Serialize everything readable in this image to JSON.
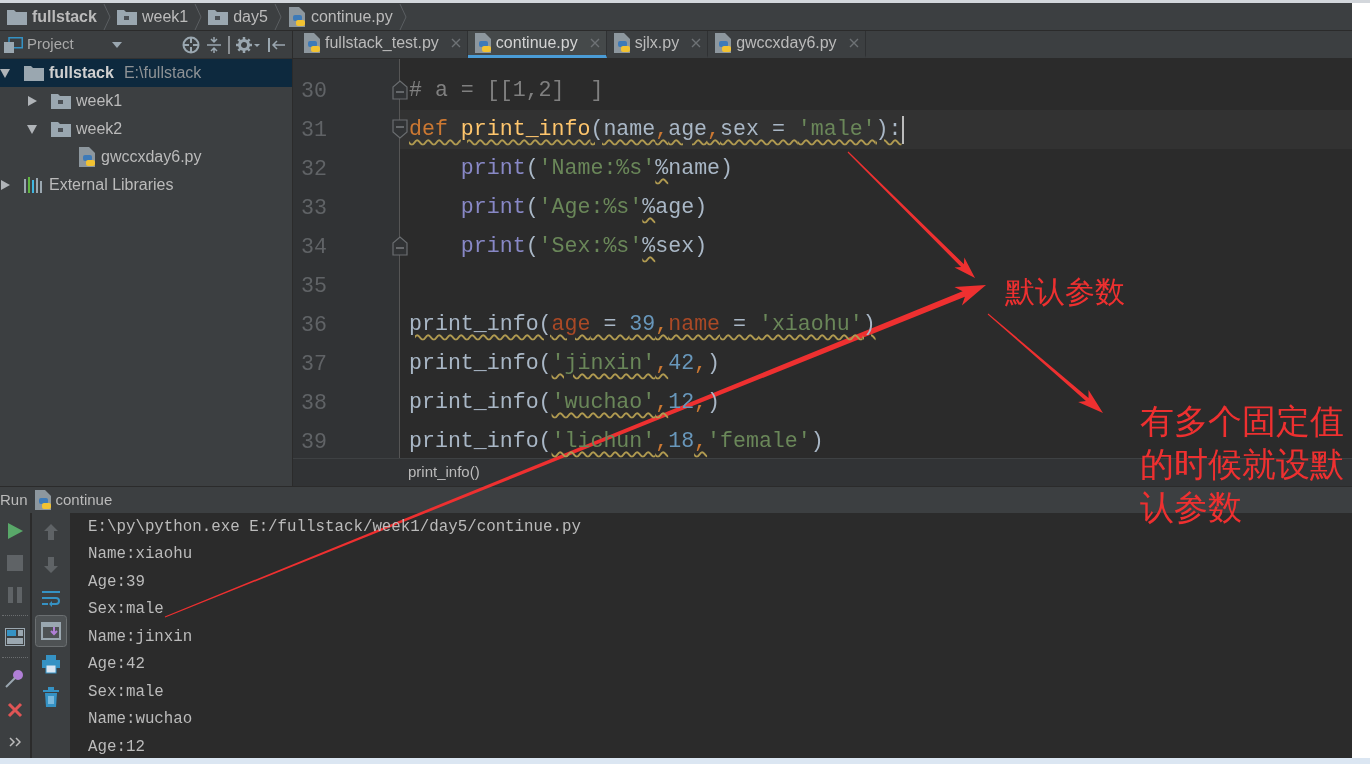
{
  "breadcrumbs": [
    {
      "label": "fullstack",
      "kind": "project"
    },
    {
      "label": "week1",
      "kind": "module"
    },
    {
      "label": "day5",
      "kind": "module"
    },
    {
      "label": "continue.py",
      "kind": "python"
    }
  ],
  "project_panel": {
    "title": "Project",
    "tree": [
      {
        "label": "fullstack",
        "path": "E:\\fullstack",
        "kind": "project",
        "expanded": true,
        "selected": true,
        "children": [
          {
            "label": "week1",
            "kind": "module",
            "expanded": false,
            "selected": false
          },
          {
            "label": "week2",
            "kind": "module",
            "expanded": true,
            "selected": false,
            "children": [
              {
                "label": "gwccxday6.py",
                "kind": "python",
                "selected": false
              }
            ]
          }
        ]
      },
      {
        "label": "External Libraries",
        "kind": "library",
        "expanded": false,
        "selected": false
      }
    ]
  },
  "editor": {
    "tabs": [
      {
        "label": "fullstack_test.py",
        "selected": false
      },
      {
        "label": "continue.py",
        "selected": true
      },
      {
        "label": "sjlx.py",
        "selected": false
      },
      {
        "label": "gwccxday6.py",
        "selected": false
      }
    ],
    "lines": [
      {
        "number": "30",
        "fold_start": false,
        "fold_end": true,
        "current": false,
        "tokens": [
          {
            "text": "# a = [[1,2]  ]",
            "kind": "comment",
            "warning": false
          }
        ]
      },
      {
        "number": "31",
        "fold_start": true,
        "fold_end": false,
        "current": true,
        "tokens": [
          {
            "text": "def ",
            "kind": "keyword",
            "warning": true
          },
          {
            "text": "print_info",
            "kind": "function",
            "warning": true
          },
          {
            "text": "(name",
            "kind": "plain",
            "warning": true
          },
          {
            "text": ",",
            "kind": "punct",
            "warning": true
          },
          {
            "text": "age",
            "kind": "plain",
            "warning": true
          },
          {
            "text": ",",
            "kind": "punct",
            "warning": true
          },
          {
            "text": "sex = ",
            "kind": "plain",
            "warning": true
          },
          {
            "text": "'male'",
            "kind": "string",
            "warning": true
          },
          {
            "text": "):",
            "kind": "plain",
            "warning": true
          }
        ]
      },
      {
        "number": "32",
        "fold_start": false,
        "fold_end": false,
        "current": false,
        "tokens": [
          {
            "text": "    print",
            "kind": "builtin",
            "warning": false
          },
          {
            "text": "(",
            "kind": "plain",
            "warning": false
          },
          {
            "text": "'Name:%s'",
            "kind": "string",
            "warning": false
          },
          {
            "text": "%",
            "kind": "plain",
            "warning": true
          },
          {
            "text": "name)",
            "kind": "plain",
            "warning": false
          }
        ]
      },
      {
        "number": "33",
        "fold_start": false,
        "fold_end": false,
        "current": false,
        "tokens": [
          {
            "text": "    print",
            "kind": "builtin",
            "warning": false
          },
          {
            "text": "(",
            "kind": "plain",
            "warning": false
          },
          {
            "text": "'Age:%s'",
            "kind": "string",
            "warning": false
          },
          {
            "text": "%",
            "kind": "plain",
            "warning": true
          },
          {
            "text": "age)",
            "kind": "plain",
            "warning": false
          }
        ]
      },
      {
        "number": "34",
        "fold_start": false,
        "fold_end": true,
        "current": false,
        "tokens": [
          {
            "text": "    print",
            "kind": "builtin",
            "warning": false
          },
          {
            "text": "(",
            "kind": "plain",
            "warning": false
          },
          {
            "text": "'Sex:%s'",
            "kind": "string",
            "warning": false
          },
          {
            "text": "%",
            "kind": "plain",
            "warning": true
          },
          {
            "text": "sex)",
            "kind": "plain",
            "warning": false
          }
        ]
      },
      {
        "number": "35",
        "fold_start": false,
        "fold_end": false,
        "current": false
      },
      {
        "number": "36",
        "fold_start": false,
        "fold_end": false,
        "current": false,
        "tokens": [
          {
            "text": "print_info(",
            "kind": "plain",
            "warning": true
          },
          {
            "text": "age",
            "kind": "param",
            "warning": true
          },
          {
            "text": " = ",
            "kind": "plain",
            "warning": true
          },
          {
            "text": "39",
            "kind": "number",
            "warning": true
          },
          {
            "text": ",",
            "kind": "punct",
            "warning": true
          },
          {
            "text": "name",
            "kind": "param",
            "warning": true
          },
          {
            "text": " = ",
            "kind": "plain",
            "warning": true
          },
          {
            "text": "'xiaohu'",
            "kind": "string",
            "warning": true
          },
          {
            "text": ")",
            "kind": "plain",
            "warning": true
          }
        ]
      },
      {
        "number": "37",
        "fold_start": false,
        "fold_end": false,
        "current": false,
        "tokens": [
          {
            "text": "print_info(",
            "kind": "plain",
            "warning": false
          },
          {
            "text": "'jinxin'",
            "kind": "string",
            "warning": true
          },
          {
            "text": ",",
            "kind": "punct",
            "warning": true
          },
          {
            "text": "42",
            "kind": "number",
            "warning": false
          },
          {
            "text": ",",
            "kind": "punct",
            "warning": false
          },
          {
            "text": ")",
            "kind": "plain",
            "warning": false
          }
        ]
      },
      {
        "number": "38",
        "fold_start": false,
        "fold_end": false,
        "current": false,
        "tokens": [
          {
            "text": "print_info(",
            "kind": "plain",
            "warning": false
          },
          {
            "text": "'wuchao'",
            "kind": "string",
            "warning": true
          },
          {
            "text": ",",
            "kind": "punct",
            "warning": true
          },
          {
            "text": "12",
            "kind": "number",
            "warning": false
          },
          {
            "text": ",",
            "kind": "punct",
            "warning": false
          },
          {
            "text": ")",
            "kind": "plain",
            "warning": false
          }
        ]
      },
      {
        "number": "39",
        "fold_start": false,
        "fold_end": false,
        "current": false,
        "tokens": [
          {
            "text": "print_info(",
            "kind": "plain",
            "warning": false
          },
          {
            "text": "'lichun'",
            "kind": "string",
            "warning": true
          },
          {
            "text": ",",
            "kind": "punct",
            "warning": true
          },
          {
            "text": "18",
            "kind": "number",
            "warning": false
          },
          {
            "text": ",",
            "kind": "punct",
            "warning": true
          },
          {
            "text": "'female'",
            "kind": "string",
            "warning": false
          },
          {
            "text": ")",
            "kind": "plain",
            "warning": false
          }
        ]
      }
    ],
    "breadcrumb": "print_info()"
  },
  "run_panel": {
    "title": "Run",
    "config": "continue",
    "actions": [
      {
        "disabled": false
      },
      {
        "disabled": true
      },
      {
        "disabled": true
      },
      {
        "disabled": false
      },
      {
        "disabled": false
      },
      {
        "disabled": false
      },
      {
        "disabled": false
      }
    ],
    "console_tools": [
      {
        "disabled": true,
        "pressed": false
      },
      {
        "disabled": true,
        "pressed": false
      },
      {
        "disabled": false,
        "pressed": false
      },
      {
        "disabled": false,
        "pressed": true
      },
      {
        "disabled": false,
        "pressed": false
      },
      {
        "disabled": false,
        "pressed": false
      }
    ],
    "output": [
      "E:\\py\\python.exe E:/fullstack/week1/day5/continue.py",
      "Name:xiaohu",
      "Age:39",
      "Sex:male",
      "Name:jinxin",
      "Age:42",
      "Sex:male",
      "Name:wuchao",
      "Age:12"
    ]
  },
  "annotations": [
    {
      "text": "默认参数"
    },
    {
      "text": "有多个固定值的时候就设默认参数"
    }
  ]
}
